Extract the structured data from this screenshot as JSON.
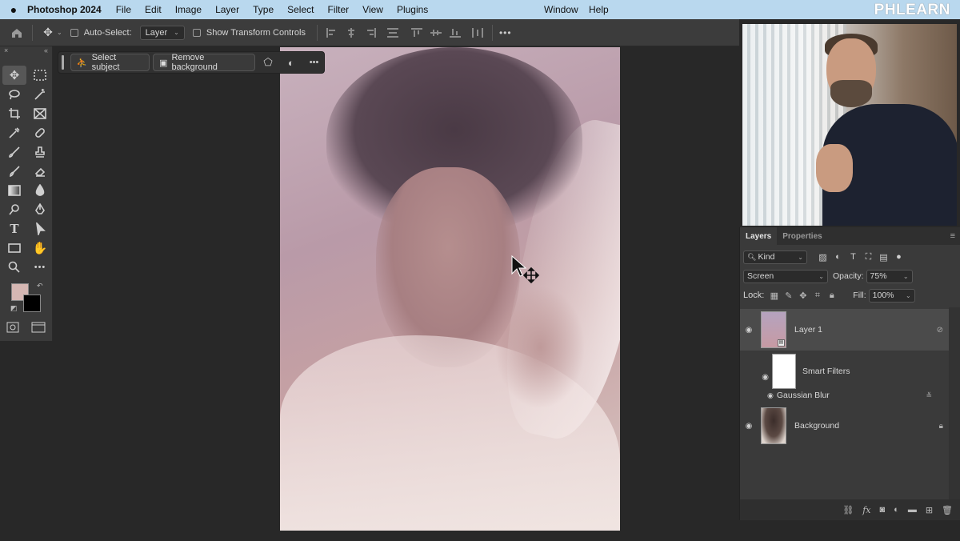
{
  "menubar": {
    "apple": "",
    "app_name": "Photoshop 2024",
    "items": [
      "File",
      "Edit",
      "Image",
      "Layer",
      "Type",
      "Select",
      "Filter",
      "View",
      "Plugins"
    ],
    "window": "Window",
    "help": "Help",
    "logo": "PHLEARN"
  },
  "options_bar": {
    "auto_select_label": "Auto-Select:",
    "auto_select_target": "Layer",
    "transform_label": "Show Transform Controls",
    "more": "•••"
  },
  "toolpanel": {
    "collapse": "×",
    "expand": "«"
  },
  "taskbar": {
    "select_subject": "Select subject",
    "remove_background": "Remove background",
    "more": "•••"
  },
  "layers_panel": {
    "tabs": [
      "Layers",
      "Properties"
    ],
    "kind_filter": "Kind",
    "blend_mode": "Screen",
    "opacity_label": "Opacity:",
    "opacity_value": "75%",
    "lock_label": "Lock:",
    "fill_label": "Fill:",
    "fill_value": "100%",
    "layers": [
      {
        "name": "Layer 1",
        "selected": true
      },
      {
        "name": "Smart Filters"
      },
      {
        "name": "Gaussian Blur"
      },
      {
        "name": "Background",
        "locked": true
      }
    ],
    "bottom_icons": [
      "link-icon",
      "fx-icon",
      "mask-icon",
      "adjustment-icon",
      "folder-icon",
      "new-layer-icon",
      "trash-icon"
    ],
    "fx": "fx"
  },
  "colors": {
    "foreground": "#d5b7b3",
    "background": "#000000",
    "menubar": "#b9d8ee"
  }
}
